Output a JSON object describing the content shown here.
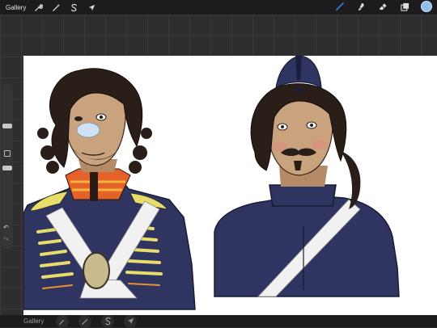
{
  "toolbar": {
    "gallery_label": "Gallery",
    "left_tools": [
      {
        "icon": "wrench-icon",
        "name": "actions"
      },
      {
        "icon": "magic-wand-icon",
        "name": "adjustments"
      },
      {
        "icon": "selection-s-icon",
        "name": "selection"
      },
      {
        "icon": "arrow-cursor-icon",
        "name": "transform"
      }
    ],
    "right_tools": [
      {
        "icon": "brush-icon",
        "name": "paint",
        "active": true
      },
      {
        "icon": "smudge-icon",
        "name": "smudge"
      },
      {
        "icon": "eraser-icon",
        "name": "eraser"
      },
      {
        "icon": "layers-icon",
        "name": "layers"
      }
    ],
    "current_color": "#8fbfea"
  },
  "bottombar": {
    "gallery_label": "Gallery"
  },
  "colors": {
    "accent": "#2f8fff",
    "bar": "#1c1c1e",
    "canvas": "#ffffff",
    "uniform_navy": "#2f3460",
    "uniform_white": "#f1f1f1",
    "hair": "#2a1e18",
    "skin": "#c9a27e",
    "collar_orange": "#e4622a",
    "lace_yellow": "#e8dd6a",
    "badge": "#c9b98e"
  }
}
